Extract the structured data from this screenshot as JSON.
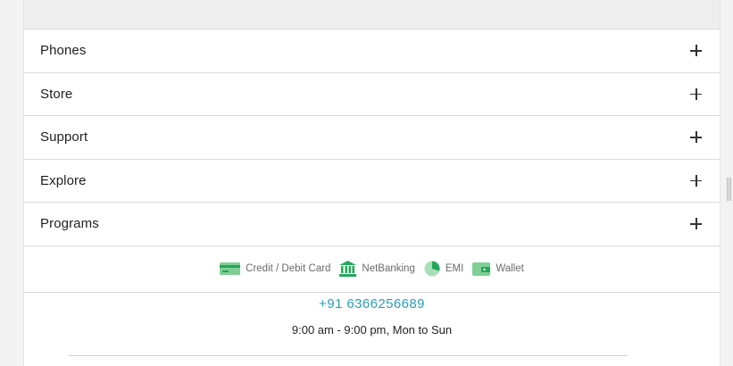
{
  "accordion": [
    {
      "label": "Phones"
    },
    {
      "label": "Store"
    },
    {
      "label": "Support"
    },
    {
      "label": "Explore"
    },
    {
      "label": "Programs"
    }
  ],
  "payments": [
    {
      "label": "Credit / Debit Card",
      "icon": "credit-card-icon"
    },
    {
      "label": "NetBanking",
      "icon": "bank-icon"
    },
    {
      "label": "EMI",
      "icon": "pie-chart-icon"
    },
    {
      "label": "Wallet",
      "icon": "wallet-icon"
    }
  ],
  "contact": {
    "phone": "+91 6366256689",
    "hours": "9:00 am - 9:00 pm, Mon to Sun"
  },
  "colors": {
    "accent_green": "#22a75a",
    "phone_blue": "#2a9dbd"
  }
}
